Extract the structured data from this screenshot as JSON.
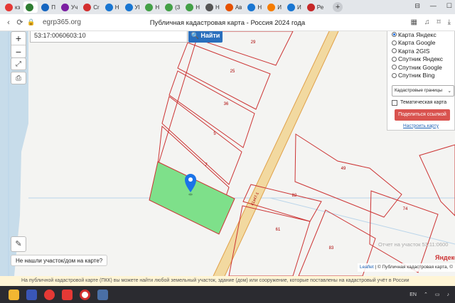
{
  "browser": {
    "tabs": [
      {
        "label": "кз",
        "color": "#e53935"
      },
      {
        "label": "",
        "color": "#2e7d32"
      },
      {
        "label": "П",
        "color": "#1565c0"
      },
      {
        "label": "Уч",
        "color": "#7b1fa2"
      },
      {
        "label": "Cr",
        "color": "#d32f2f"
      },
      {
        "label": "Н",
        "color": "#1976d2"
      },
      {
        "label": "Уl",
        "color": "#1976d2"
      },
      {
        "label": "Н",
        "color": "#43a047"
      },
      {
        "label": "(3",
        "color": "#43a047"
      },
      {
        "label": "Н",
        "color": "#43a047"
      },
      {
        "label": "Н",
        "color": "#555555"
      },
      {
        "label": "Ав",
        "color": "#e65100"
      },
      {
        "label": "Н",
        "color": "#1976d2"
      },
      {
        "label": "И",
        "color": "#f57c00"
      },
      {
        "label": "И",
        "color": "#1976d2"
      },
      {
        "label": "Ре",
        "color": "#c62828"
      }
    ],
    "new_tab": "+",
    "url": "egrp365.org",
    "page_title": "Публичная кадастровая карта - Россия 2024 года"
  },
  "search": {
    "value": "53:17:0060603:10",
    "button": "Найти"
  },
  "zoom": {
    "plus": "+",
    "minus": "−"
  },
  "layers": {
    "options": [
      "Карта Яндекс",
      "Карта Google",
      "Карта 2GIS",
      "Спутник Яндекс",
      "Спутник Google",
      "Спутник Bing"
    ],
    "selected_index": 0,
    "select_value": "Кадастровые границы",
    "checkbox_label": "Тематическая карта",
    "share_button": "Поделиться ссылкой",
    "setup_link": "Настроить карту"
  },
  "map": {
    "parcels": [
      "29",
      "25",
      "36",
      "5",
      "7",
      "49",
      "82",
      "74",
      "61",
      "83"
    ],
    "road_label": "41э47-1",
    "watermark": "Отчет на участок 53:11:0600",
    "yandex": "Яндекс",
    "attribution_leaflet": "Leaflet",
    "attribution_text": "| © Публичная кадастровая карта, ©"
  },
  "not_found": "Не нашли участок/дом на карте?",
  "notice": "На публичной кадастровой карте (ПКК) вы можете найти любой земельный участок, здание (дом) или сооружение, которые поставлены на кадастровый учёт в России",
  "colors": {
    "selected_parcel": "#7ee08a",
    "parcel_line": "#cc3333",
    "pin": "#1a73e8",
    "share": "#d9534f"
  },
  "taskbar": {
    "lang": "EN"
  }
}
